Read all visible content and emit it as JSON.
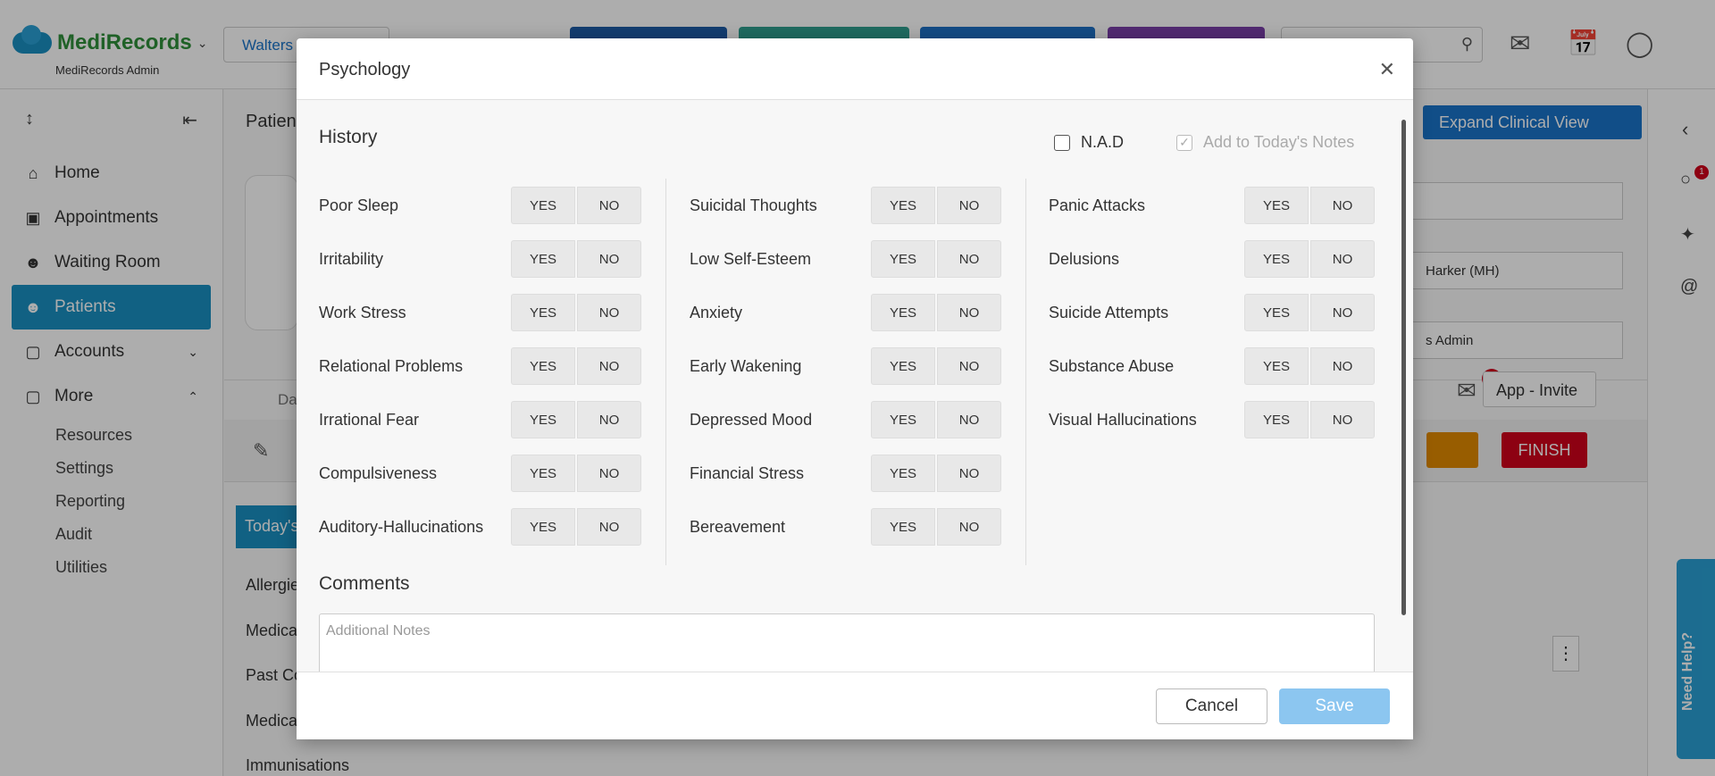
{
  "app": {
    "name": "MediRecords",
    "subtitle": "MediRecords Admin",
    "patient_selector": "Walters"
  },
  "sidebar": {
    "items": [
      {
        "label": "Home"
      },
      {
        "label": "Appointments"
      },
      {
        "label": "Waiting Room"
      },
      {
        "label": "Patients"
      },
      {
        "label": "Accounts"
      },
      {
        "label": "More"
      }
    ],
    "sub_items": [
      "Resources",
      "Settings",
      "Reporting",
      "Audit",
      "Utilities"
    ]
  },
  "background": {
    "patient_heading": "Patien",
    "expand_button": "Expand Clinical View",
    "doctor_field": "Harker (MH)",
    "admin_field": "s Admin",
    "app_invite": "App - Invite",
    "finish": "FINISH",
    "mail_badge": "1",
    "chat_badge": "1",
    "tab_partial": "Da",
    "today_tab": "Today's",
    "left_list": [
      "Allergie",
      "Medica",
      "Past Co",
      "Medica",
      "Immunisations"
    ],
    "need_help": "Need Help?"
  },
  "modal": {
    "title": "Psychology",
    "history_title": "History",
    "nad_label": "N.A.D",
    "add_notes_label": "Add to Today's Notes",
    "yes": "YES",
    "no": "NO",
    "columns": [
      [
        "Poor Sleep",
        "Irritability",
        "Work Stress",
        "Relational Problems",
        "Irrational Fear",
        "Compulsiveness",
        "Auditory-Hallucinations"
      ],
      [
        "Suicidal Thoughts",
        "Low Self-Esteem",
        "Anxiety",
        "Early Wakening",
        "Depressed Mood",
        "Financial Stress",
        "Bereavement"
      ],
      [
        "Panic Attacks",
        "Delusions",
        "Suicide Attempts",
        "Substance Abuse",
        "Visual Hallucinations"
      ]
    ],
    "comments_title": "Comments",
    "notes_placeholder": "Additional Notes",
    "cancel_label": "Cancel",
    "save_label": "Save"
  }
}
